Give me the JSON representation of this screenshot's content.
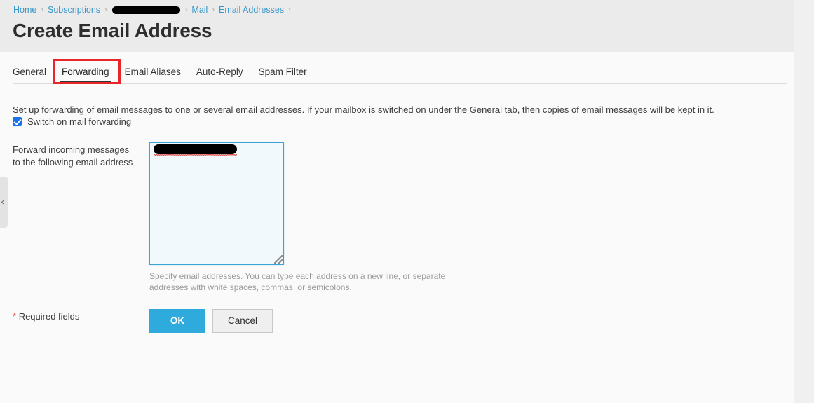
{
  "breadcrumb": {
    "items": [
      {
        "label": "Home",
        "type": "link"
      },
      {
        "label": "Subscriptions",
        "type": "link"
      },
      {
        "label": "",
        "type": "redacted"
      },
      {
        "label": "Mail",
        "type": "link"
      },
      {
        "label": "Email Addresses",
        "type": "link"
      }
    ],
    "separator": "›"
  },
  "header": {
    "title": "Create Email Address"
  },
  "tabs": [
    {
      "label": "General",
      "active": false
    },
    {
      "label": "Forwarding",
      "active": true
    },
    {
      "label": "Email Aliases",
      "active": false
    },
    {
      "label": "Auto-Reply",
      "active": false
    },
    {
      "label": "Spam Filter",
      "active": false
    }
  ],
  "main": {
    "description": "Set up forwarding of email messages to one or several email addresses. If your mailbox is switched on under the General tab, then copies of email messages will be kept in it.",
    "switch_on_label": "Switch on mail forwarding",
    "switch_on_checked": true,
    "field_label": "Forward incoming messages to the following email address",
    "textarea_value": "",
    "textarea_hint": "Specify email addresses. You can type each address on a new line, or separate addresses with white spaces, commas, or semicolons."
  },
  "footer": {
    "required_star": "*",
    "required_label": "Required fields",
    "ok_label": "OK",
    "cancel_label": "Cancel"
  },
  "colors": {
    "accent_primary": "#2eaadc",
    "link": "#3a97c9",
    "annotation": "#e8252a",
    "checkbox": "#1a73e8",
    "header_band": "#ebebeb",
    "panel": "#fafafa",
    "required_star": "#d9534f"
  }
}
